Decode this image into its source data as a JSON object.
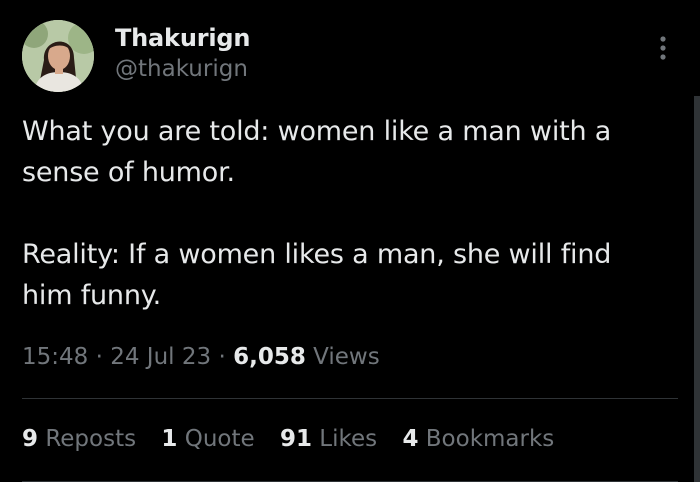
{
  "author": {
    "display_name": "Thakurign",
    "handle": "@thakurign"
  },
  "tweet": {
    "text": "What you are told: women like a man with a\nsense of humor.\n\nReality: If a women likes a man, she will find\nhim funny.",
    "time": "15:48",
    "date": "24 Jul 23",
    "separator": "·",
    "views_count": "6,058",
    "views_label": "Views"
  },
  "stats": [
    {
      "count": "9",
      "label": "Reposts"
    },
    {
      "count": "1",
      "label": "Quote"
    },
    {
      "count": "91",
      "label": "Likes"
    },
    {
      "count": "4",
      "label": "Bookmarks"
    }
  ],
  "colors": {
    "background": "#000000",
    "primary_text": "#e7e9ea",
    "secondary_text": "#71767b",
    "divider": "#2f3336"
  },
  "icons": {
    "more": "more-vertical-icon",
    "avatar": "avatar"
  }
}
